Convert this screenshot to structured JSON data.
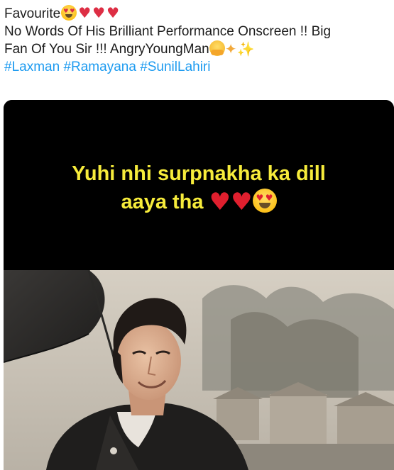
{
  "post": {
    "line1": "Favourite",
    "line2": "No Words Of His Brilliant Performance Onscreen !! Big",
    "line3": "Fan Of You Sir !!! AngryYoungMan",
    "hashtags": [
      "#Laxman",
      "#Ramayana",
      "#SunilLahiri"
    ]
  },
  "media": {
    "caption_line1": "Yuhi nhi surpnakha ka dill",
    "caption_line2": "aaya tha",
    "caption_color": "#f7ec3b",
    "band_color": "#000000"
  },
  "icons": {
    "heart_eyes": "heart-eyes-emoji",
    "heart": "red-heart-emoji",
    "hugging": "hugging-face-emoji",
    "dizzy": "dizzy-emoji",
    "sparkles": "sparkles-emoji"
  },
  "colors": {
    "hashtag": "#1d9bf0",
    "text": "#1c1c1c"
  }
}
